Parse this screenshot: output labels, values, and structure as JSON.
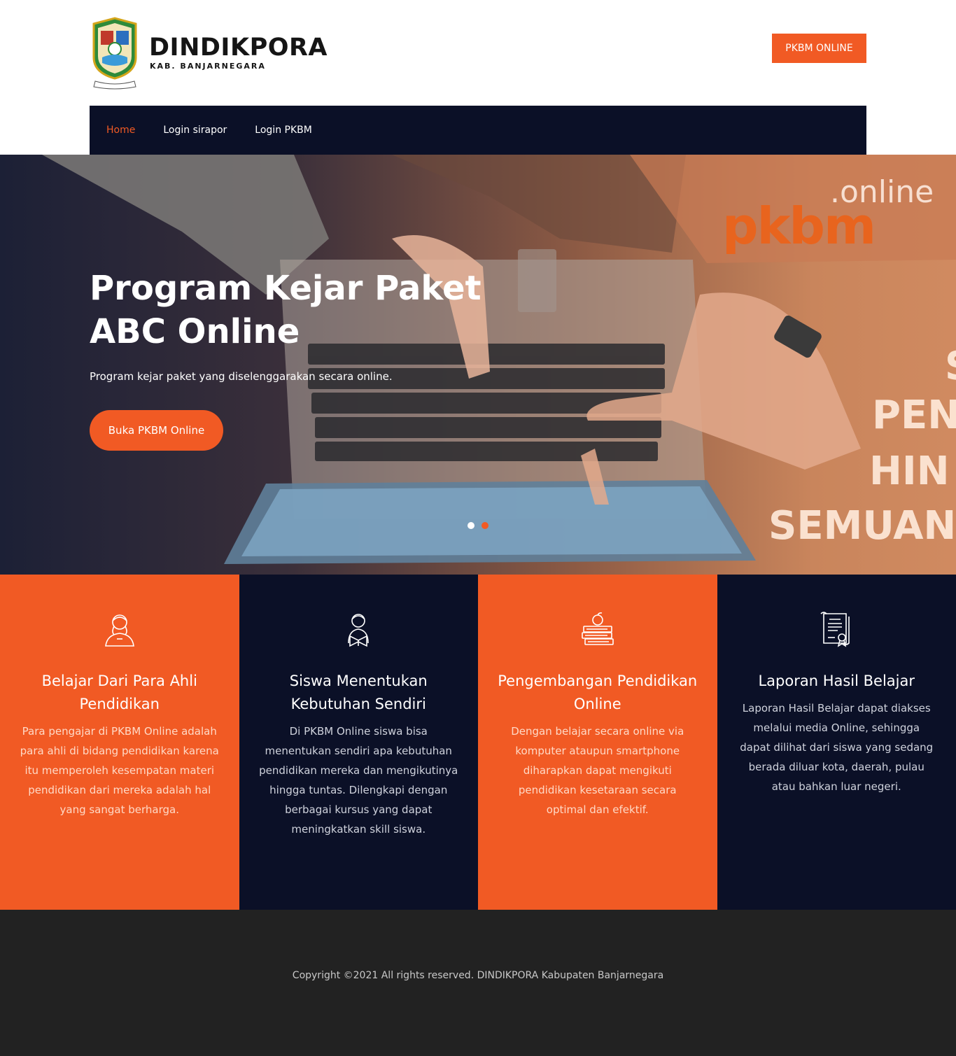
{
  "header": {
    "brand_title": "DINDIKPORA",
    "brand_subtitle": "KAB. BANJARNEGARA",
    "cta_label": "PKBM ONLINE"
  },
  "nav": {
    "items": [
      {
        "label": "Home",
        "active": true
      },
      {
        "label": "Login sirapor",
        "active": false
      },
      {
        "label": "Login PKBM",
        "active": false
      }
    ]
  },
  "hero": {
    "title": "Program Kejar Paket ABC Online",
    "subtitle": "Program kejar paket yang diselenggarakan secara online.",
    "button_label": "Buka PKBM Online",
    "slides_count": 2,
    "active_slide": 2,
    "image_text": {
      "online": ".online",
      "pkbm": "pkbm",
      "line1": "S",
      "line2": "PEN",
      "line3": "HIN",
      "line4": "SEMUAN"
    }
  },
  "features": [
    {
      "icon": "teacher-icon",
      "title": "Belajar Dari Para Ahli Pendidikan",
      "text": "Para pengajar di PKBM Online adalah para ahli di bidang pendidikan karena itu memperoleh kesempatan materi pendidikan dari mereka adalah hal yang sangat berharga.",
      "theme": "orange"
    },
    {
      "icon": "student-reading-icon",
      "title": "Siswa Menentukan Kebutuhan Sendiri",
      "text": "Di PKBM Online siswa bisa menentukan sendiri apa kebutuhan pendidikan mereka dan mengikutinya hingga tuntas. Dilengkapi dengan berbagai kursus yang dapat meningkatkan skill siswa.",
      "theme": "navy"
    },
    {
      "icon": "books-apple-icon",
      "title": "Pengembangan Pendidikan Online",
      "text": "Dengan belajar secara online via komputer ataupun smartphone diharapkan dapat mengikuti pendidikan kesetaraan secara optimal dan efektif.",
      "theme": "orange"
    },
    {
      "icon": "certificate-icon",
      "title": "Laporan Hasil Belajar",
      "text": "Laporan Hasil Belajar dapat diakses melalui media Online, sehingga dapat dilihat dari siswa yang sedang berada diluar kota, daerah, pulau atau bahkan luar negeri.",
      "theme": "navy"
    }
  ],
  "footer": {
    "copyright": "Copyright ©2021 All rights reserved. DINDIKPORA Kabupaten Banjarnegara"
  },
  "colors": {
    "accent": "#f15a24",
    "navy": "#0b1027",
    "footer": "#222222"
  }
}
